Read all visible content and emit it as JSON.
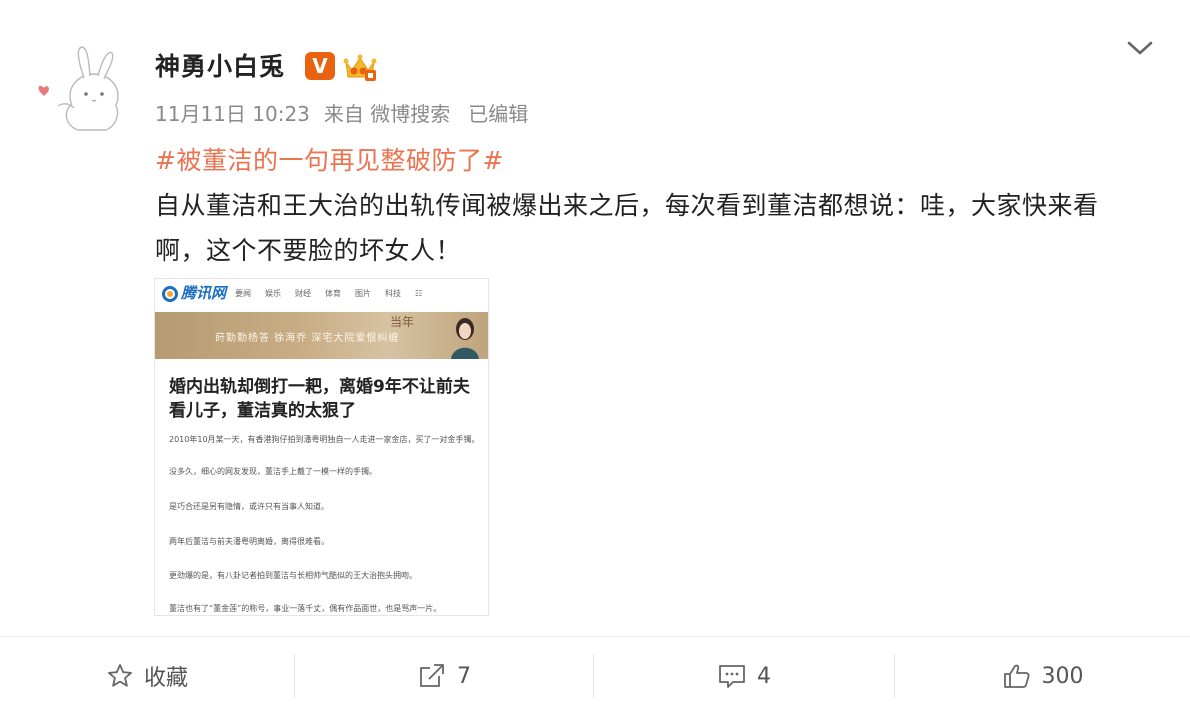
{
  "post": {
    "username": "神勇小白兎",
    "verified_badge": "V",
    "meta": {
      "date": "11月11日 10:23",
      "source": "来自 微博搜索",
      "edited": "已编辑"
    },
    "hashtag": "#被董洁的一句再见整破防了#",
    "content": "自从董洁和王大治的出轨传闻被爆出来之后，每次看到董洁都想说：哇，大家快来看啊，这个不要脸的坏女人！"
  },
  "embedded_article": {
    "brand": "腾讯网",
    "nav_items": [
      "要闻",
      "娱乐",
      "财经",
      "体育",
      "图片",
      "科技",
      "☷"
    ],
    "banner_text": "莳勤勤杨答 徐海乔 深宅大院爱恨纠缠",
    "banner_deco": "当年",
    "title": "婚内出轨却倒打一耙，离婚9年不让前夫看儿子，董洁真的太狠了",
    "paragraphs": [
      "2010年10月某一天，有香港狗仔拍到潘粤明独自一人走进一家金店，买了一对金手镯。",
      "没多久，细心的网友发现，董洁手上戴了一模一样的手镯。",
      "是巧合还是另有隐情，或许只有当事人知道。",
      "两年后董洁与前夫潘粤明离婚，离得很难看。",
      "更劲爆的是，有八卦记者拍到董洁与长相帅气酷似的王大治抱头拥吻。",
      "董洁也有了“董金莲”的称号，事业一落千丈，偶有作品面世，也是骂声一片。"
    ]
  },
  "actions": {
    "favorite_label": "收藏",
    "repost_count": "7",
    "comment_count": "4",
    "like_count": "300"
  },
  "colors": {
    "hashtag": "#eb7350",
    "verified_badge": "#e8620f",
    "brand_blue": "#1b6ec2"
  },
  "icons": [
    "avatar-rabbit",
    "chevron-down-icon",
    "verified-v-icon",
    "vip-crown-icon",
    "star-icon",
    "repost-icon",
    "comment-icon",
    "thumbs-up-icon"
  ]
}
